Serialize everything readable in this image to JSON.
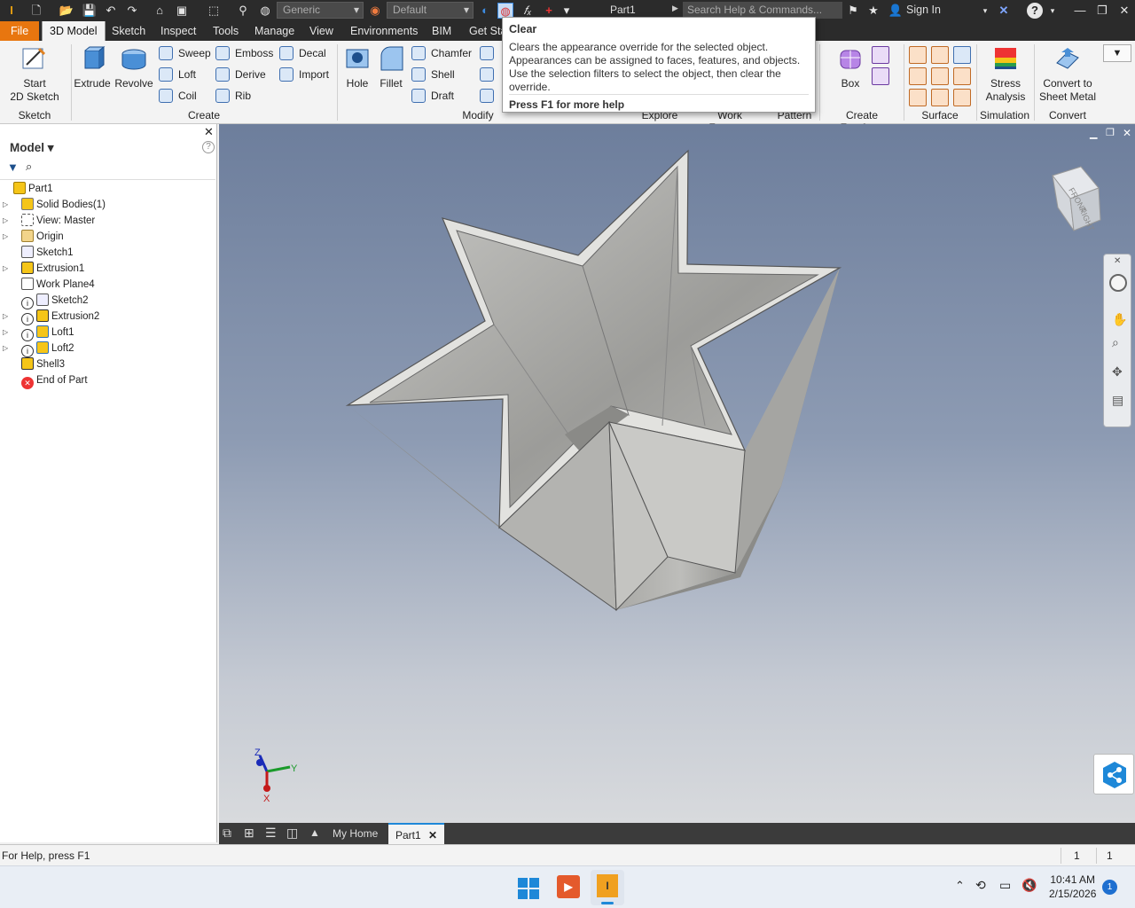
{
  "qat": {
    "material": "Generic",
    "appearance": "Default",
    "doc_title": "Part1",
    "search_placeholder": "Search Help & Commands...",
    "sign_in": "Sign In"
  },
  "tabs": [
    "File",
    "3D Model",
    "Sketch",
    "Inspect",
    "Tools",
    "Manage",
    "View",
    "Environments",
    "BIM",
    "Get Sta"
  ],
  "ribbon": {
    "sketch": {
      "start": "Start",
      "start2": "2D Sketch",
      "label": "Sketch"
    },
    "create": {
      "extrude": "Extrude",
      "revolve": "Revolve",
      "sweep": "Sweep",
      "loft": "Loft",
      "coil": "Coil",
      "emboss": "Emboss",
      "derive": "Derive",
      "rib": "Rib",
      "decal": "Decal",
      "import": "Import",
      "label": "Create"
    },
    "modify": {
      "hole": "Hole",
      "fillet": "Fillet",
      "chamfer": "Chamfer",
      "shell": "Shell",
      "draft": "Draft",
      "label": "Modify"
    },
    "explore": "Explore",
    "work_features": "Work Features",
    "pattern": "Pattern",
    "freeform": {
      "box": "Box",
      "label": "Create Freeform"
    },
    "surface": "Surface",
    "simulation": {
      "stress": "Stress",
      "stress2": "Analysis",
      "label": "Simulation"
    },
    "convert": {
      "c1": "Convert to",
      "c2": "Sheet Metal",
      "label": "Convert"
    }
  },
  "tooltip": {
    "title": "Clear",
    "description": "Clears the appearance override for the selected object. Appearances can be assigned to faces, features, and objects. Use the selection filters to select the object, then clear the override.",
    "help": "Press F1 for more help"
  },
  "browser": {
    "title": "Model",
    "items": [
      {
        "label": "Part1",
        "icon": "part-icon"
      },
      {
        "label": "Solid Bodies(1)",
        "icon": "solid-bodies-icon"
      },
      {
        "label": "View: Master",
        "icon": "view-icon"
      },
      {
        "label": "Origin",
        "icon": "folder-icon"
      },
      {
        "label": "Sketch1",
        "icon": "sketch-icon"
      },
      {
        "label": "Extrusion1",
        "icon": "extrusion-icon"
      },
      {
        "label": "Work Plane4",
        "icon": "work-plane-icon"
      },
      {
        "label": "Sketch2",
        "icon": "sketch-icon"
      },
      {
        "label": "Extrusion2",
        "icon": "extrusion-icon"
      },
      {
        "label": "Loft1",
        "icon": "loft-icon"
      },
      {
        "label": "Loft2",
        "icon": "loft-icon"
      },
      {
        "label": "Shell3",
        "icon": "shell-icon"
      },
      {
        "label": "End of Part",
        "icon": "end-of-part-icon"
      }
    ]
  },
  "viewcube": {
    "front": "FRONT",
    "right": "RIGHT"
  },
  "triad": {
    "z": "Z",
    "y": "Y",
    "x": "X"
  },
  "doctabs": {
    "home": "My Home",
    "part": "Part1"
  },
  "status": {
    "help": "For Help, press F1",
    "count1": "1",
    "count2": "1"
  },
  "taskbar": {
    "time": "10:41 AM",
    "date": "2/15/2026",
    "badge": "1"
  }
}
